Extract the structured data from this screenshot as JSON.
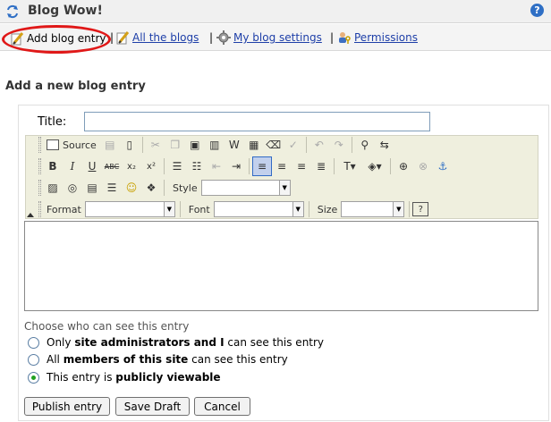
{
  "app": {
    "title": "Blog Wow!"
  },
  "nav": {
    "items": [
      {
        "label": "Add blog entry"
      },
      {
        "label": "All the blogs"
      },
      {
        "label": "My blog settings"
      },
      {
        "label": "Permissions"
      }
    ],
    "separator": "|"
  },
  "section": {
    "heading": "Add a new blog entry"
  },
  "form": {
    "title_label": "Title:",
    "title_value": "",
    "toolbar": {
      "source_label": "Source",
      "style_label": "Style",
      "format_label": "Format",
      "font_label": "Font",
      "size_label": "Size",
      "style_value": "",
      "format_value": "",
      "font_value": "",
      "size_value": ""
    },
    "body_value": "",
    "visibility": {
      "prompt": "Choose who can see this entry",
      "options": [
        {
          "pre": "Only ",
          "bold": "site administrators and I",
          "post": " can see this entry",
          "checked": false
        },
        {
          "pre": "All ",
          "bold": "members of this site",
          "post": " can see this entry",
          "checked": false
        },
        {
          "pre": "This entry is ",
          "bold": "publicly viewable",
          "post": "",
          "checked": true
        }
      ]
    },
    "buttons": {
      "publish": "Publish entry",
      "save_draft": "Save Draft",
      "cancel": "Cancel"
    }
  },
  "colors": {
    "link": "#1e3fa8",
    "highlight_ring": "#e01818",
    "radio_checked": "#21a121"
  }
}
